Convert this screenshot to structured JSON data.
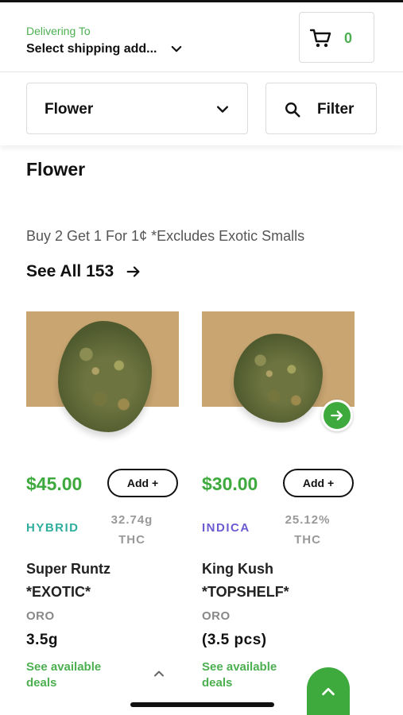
{
  "header": {
    "delivering_label": "Delivering To",
    "address_value": "Select shipping add...",
    "cart_count": "0"
  },
  "filterbar": {
    "category_selected": "Flower",
    "filter_label": "Filter"
  },
  "section": {
    "title": "Flower",
    "promo": "Buy 2 Get 1 For 1¢ *Excludes Exotic Smalls",
    "see_all": "See All 153"
  },
  "products": [
    {
      "price": "$45.00",
      "add_label": "Add +",
      "strain": "HYBRID",
      "thc_value": "32.74g",
      "thc_label": "THC",
      "name_line1": "Super Runtz",
      "name_line2": "*EXOTIC*",
      "brand": "ORO",
      "size": "3.5g",
      "deals_line1": "See available",
      "deals_line2": "deals"
    },
    {
      "price": "$30.00",
      "add_label": "Add +",
      "strain": "INDICA",
      "thc_value": "25.12%",
      "thc_label": "THC",
      "name_line1": "King Kush",
      "name_line2": "*TOPSHELF*",
      "brand": "ORO",
      "size": "(3.5 pcs)",
      "deals_line1": "See available",
      "deals_line2": "deals"
    }
  ],
  "colors": {
    "accent_green": "#3eaa3e",
    "hybrid": "#2fae9d",
    "indica": "#6b5bd0"
  },
  "icons": {
    "cart": "cart-icon",
    "chevron": "chevron-down-icon",
    "search": "search-icon",
    "arrow": "arrow-right-icon",
    "scroll_top": "chevron-up-icon"
  }
}
